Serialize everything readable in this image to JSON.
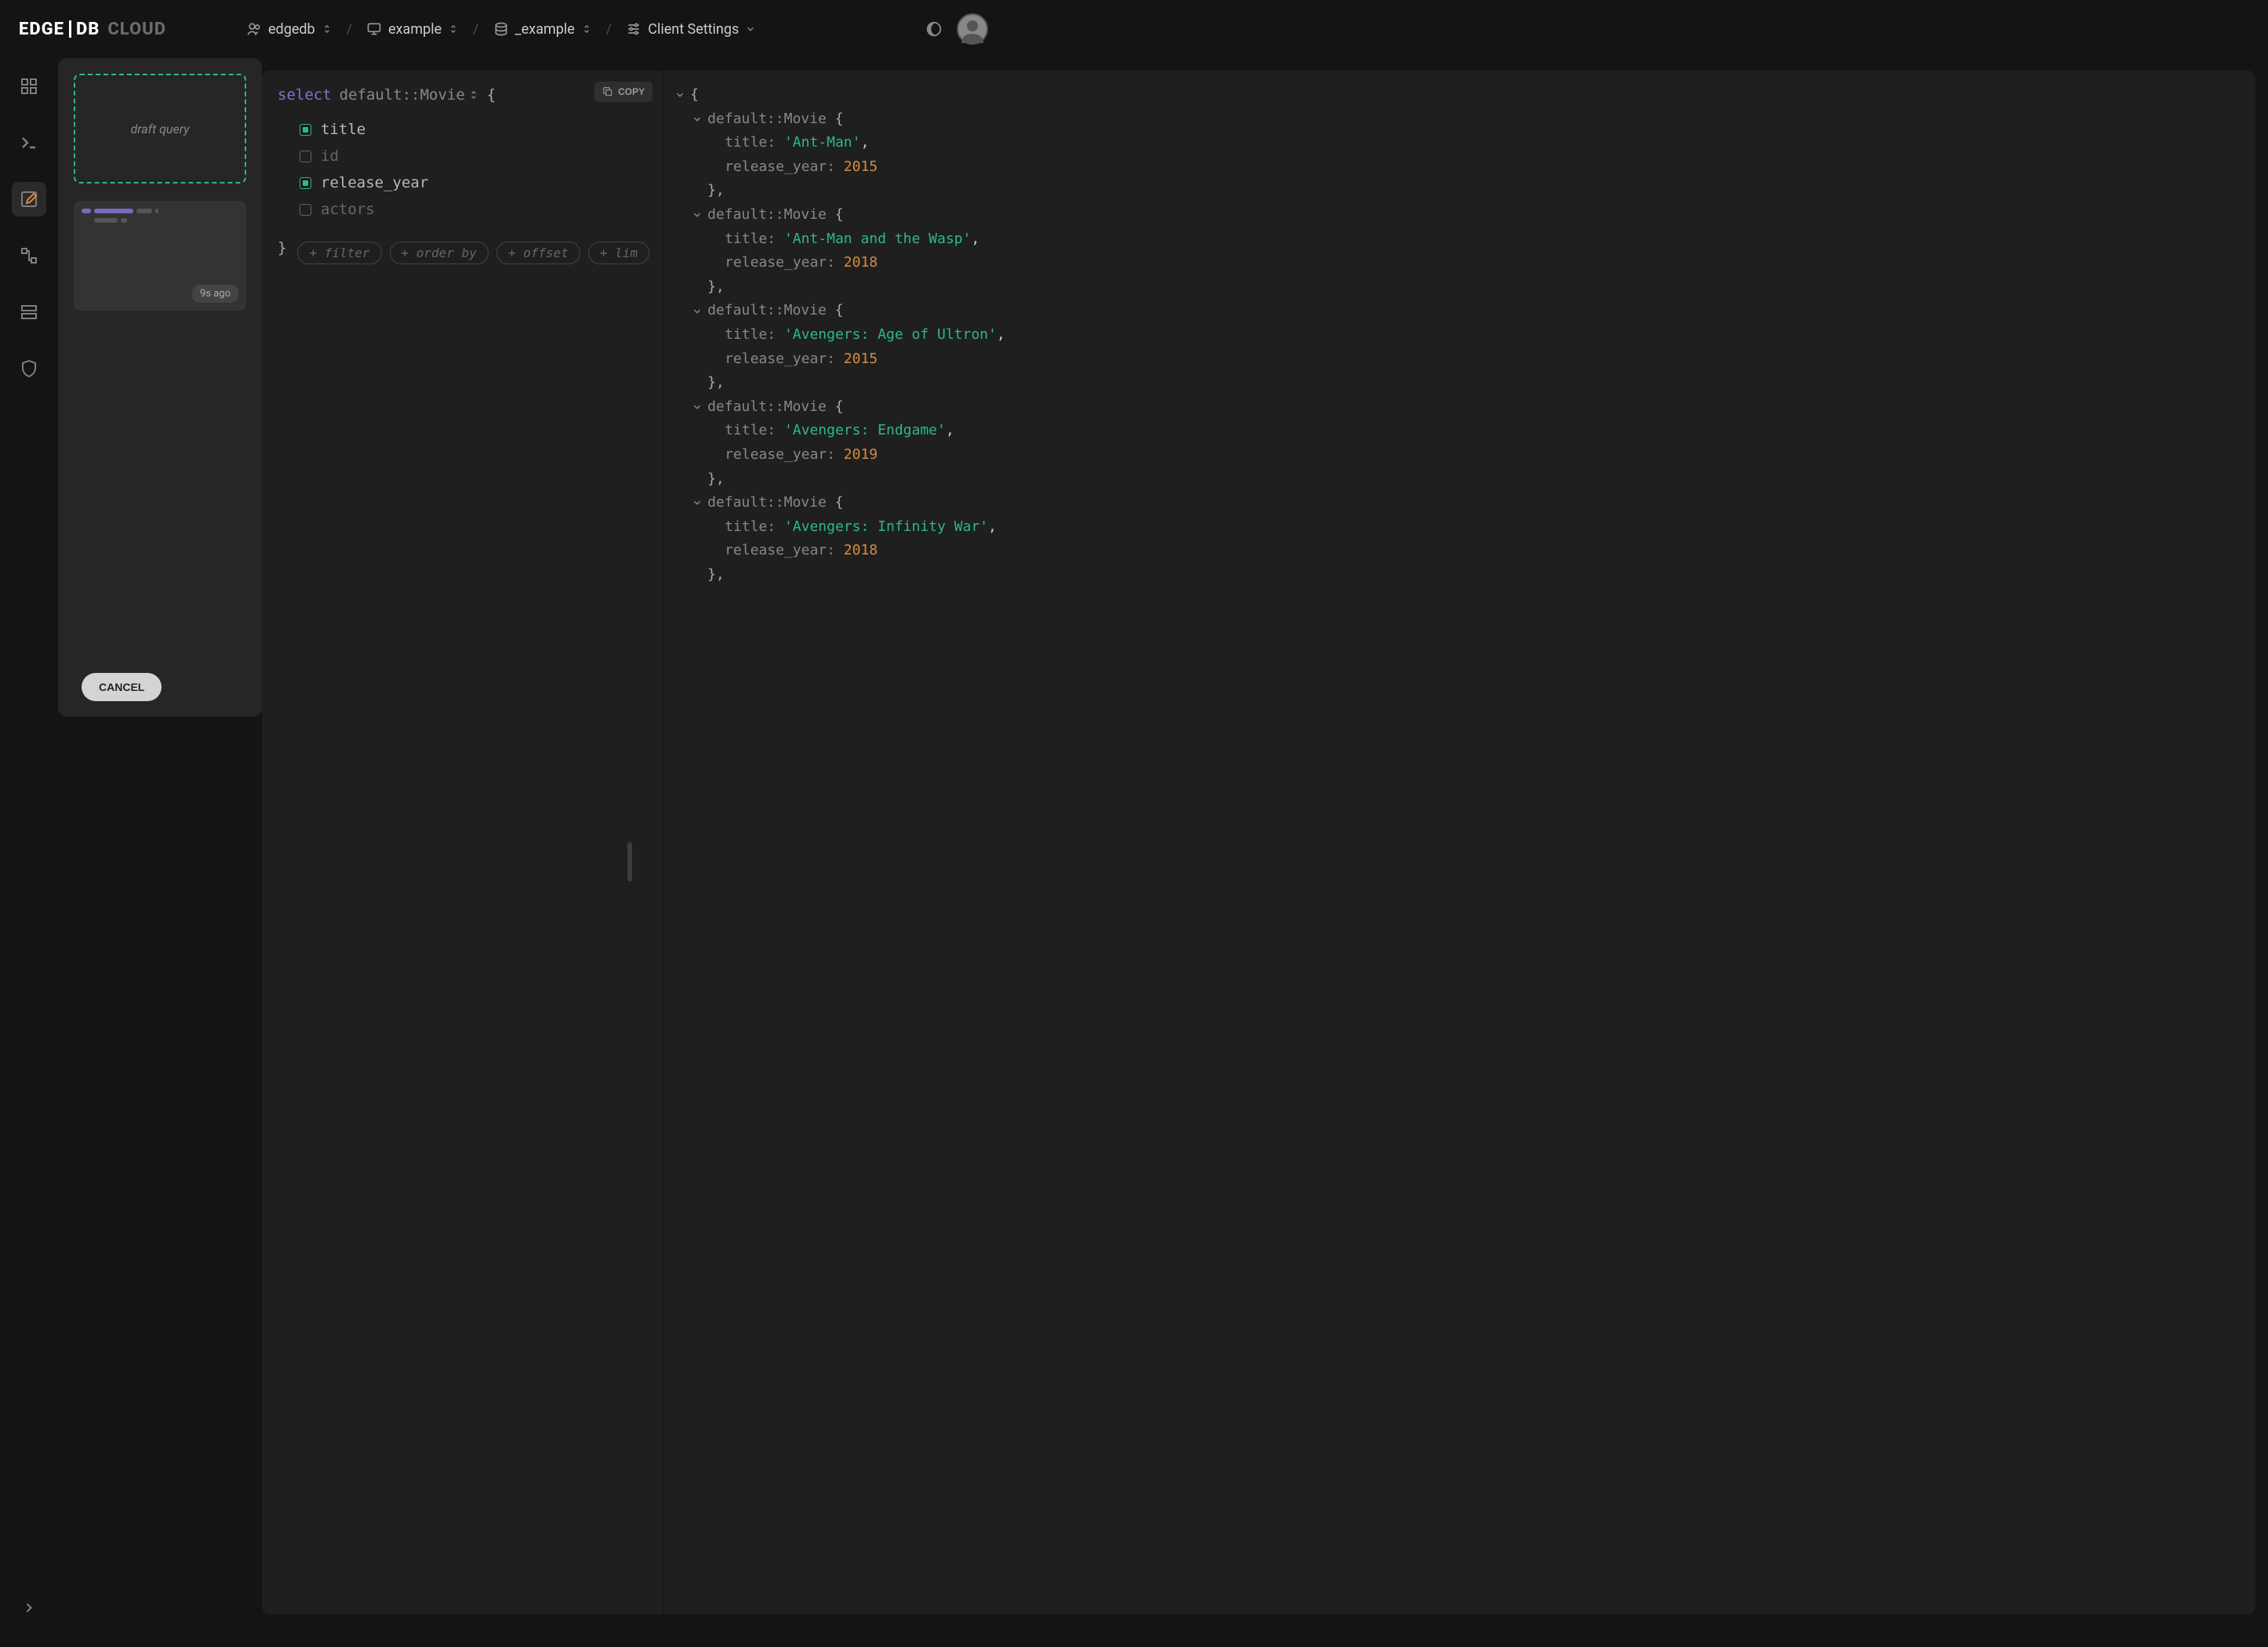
{
  "logo": {
    "left": "EDGE",
    "right": "DB",
    "cloud": "CLOUD"
  },
  "breadcrumbs": {
    "org": "edgedb",
    "instance": "example",
    "database": "_example",
    "settings": "Client Settings"
  },
  "history": {
    "draft_label": "draft query",
    "items": [
      {
        "time": "9s ago"
      }
    ],
    "cancel": "CANCEL"
  },
  "query": {
    "copy_label": "COPY",
    "select_keyword": "select",
    "type_name": "default::Movie",
    "open_brace": "{",
    "close_brace": "}",
    "fields": [
      {
        "name": "title",
        "checked": true
      },
      {
        "name": "id",
        "checked": false
      },
      {
        "name": "release_year",
        "checked": true
      },
      {
        "name": "actors",
        "checked": false
      }
    ],
    "clauses": [
      "+ filter",
      "+ order by",
      "+ offset",
      "+ lim"
    ]
  },
  "results": {
    "open_brace": "{",
    "type_label": "default::Movie",
    "obj_open": "{",
    "obj_close": "},",
    "title_key": "title:",
    "year_key": "release_year:",
    "rows": [
      {
        "title": "'Ant-Man'",
        "year": "2015",
        "trail": ","
      },
      {
        "title": "'Ant-Man and the Wasp'",
        "year": "2018",
        "trail": ","
      },
      {
        "title": "'Avengers: Age of Ultron'",
        "year": "2015",
        "trail": ","
      },
      {
        "title": "'Avengers: Endgame'",
        "year": "2019",
        "trail": ","
      },
      {
        "title": "'Avengers: Infinity War'",
        "year": "2018",
        "trail": ","
      }
    ]
  }
}
